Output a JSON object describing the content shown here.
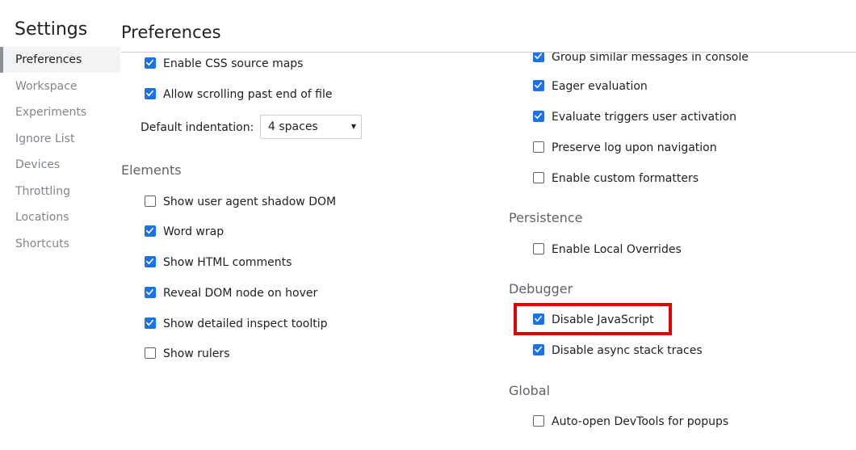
{
  "sidebar": {
    "title": "Settings",
    "items": [
      {
        "label": "Preferences",
        "selected": true
      },
      {
        "label": "Workspace"
      },
      {
        "label": "Experiments"
      },
      {
        "label": "Ignore List"
      },
      {
        "label": "Devices"
      },
      {
        "label": "Throttling"
      },
      {
        "label": "Locations"
      },
      {
        "label": "Shortcuts"
      }
    ]
  },
  "page": {
    "title": "Preferences"
  },
  "left_column": {
    "top_items": [
      {
        "label": "Enable CSS source maps",
        "checked": true
      },
      {
        "label": "Allow scrolling past end of file",
        "checked": true
      }
    ],
    "indentation": {
      "label": "Default indentation:",
      "value": "4 spaces"
    },
    "elements": {
      "title": "Elements",
      "items": [
        {
          "label": "Show user agent shadow DOM",
          "checked": false
        },
        {
          "label": "Word wrap",
          "checked": true
        },
        {
          "label": "Show HTML comments",
          "checked": true
        },
        {
          "label": "Reveal DOM node on hover",
          "checked": true
        },
        {
          "label": "Show detailed inspect tooltip",
          "checked": true
        },
        {
          "label": "Show rulers",
          "checked": false
        }
      ]
    }
  },
  "right_column": {
    "console_items": [
      {
        "label": "Group similar messages in console",
        "checked": true
      },
      {
        "label": "Eager evaluation",
        "checked": true
      },
      {
        "label": "Evaluate triggers user activation",
        "checked": true
      },
      {
        "label": "Preserve log upon navigation",
        "checked": false
      },
      {
        "label": "Enable custom formatters",
        "checked": false
      }
    ],
    "persistence": {
      "title": "Persistence",
      "items": [
        {
          "label": "Enable Local Overrides",
          "checked": false
        }
      ]
    },
    "debugger": {
      "title": "Debugger",
      "items": [
        {
          "label": "Disable JavaScript",
          "checked": true
        },
        {
          "label": "Disable async stack traces",
          "checked": true
        }
      ]
    },
    "global": {
      "title": "Global",
      "items": [
        {
          "label": "Auto-open DevTools for popups",
          "checked": false
        }
      ]
    }
  },
  "colors": {
    "accent": "#1a73e8",
    "highlight": "#e00000"
  }
}
